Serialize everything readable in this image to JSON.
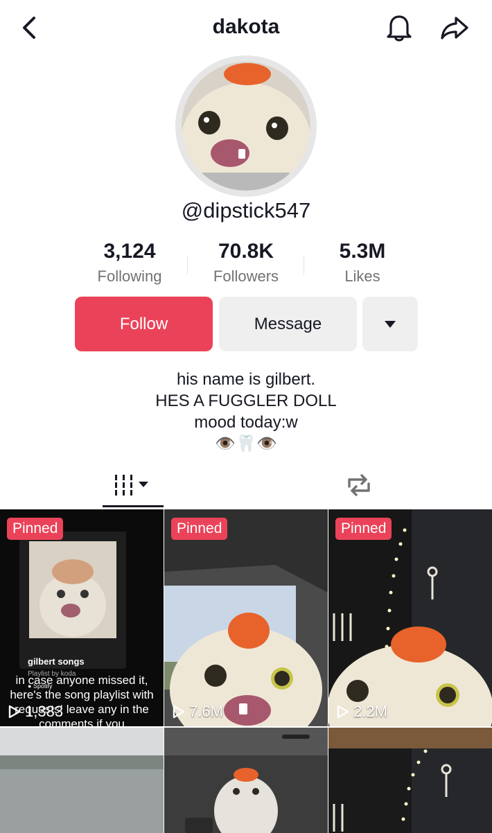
{
  "header": {
    "title": "dakota"
  },
  "profile": {
    "handle": "@dipstick547"
  },
  "stats": [
    {
      "value": "3,124",
      "label": "Following"
    },
    {
      "value": "70.8K",
      "label": "Followers"
    },
    {
      "value": "5.3M",
      "label": "Likes"
    }
  ],
  "actions": {
    "follow": "Follow",
    "message": "Message"
  },
  "bio": {
    "line1": "his name is gilbert.",
    "line2": "HES A FUGGLER DOLL",
    "line3": "mood today:w",
    "line4": "👁️🦷👁️"
  },
  "videos": [
    {
      "pinned": "Pinned",
      "views": "1,383",
      "overlay_text": "in case anyone missed it, here's the song playlist with requests! leave any in the comments if you",
      "playlist_title": "gilbert songs",
      "playlist_sub": "Playlist by koda",
      "playlist_source": "Spotify"
    },
    {
      "pinned": "Pinned",
      "views": "7.6M"
    },
    {
      "pinned": "Pinned",
      "views": "2.2M"
    },
    {
      "views": ""
    },
    {
      "views": ""
    },
    {
      "views": ""
    }
  ],
  "colors": {
    "accent": "#ea4359",
    "secondary_button": "#efefef",
    "muted_text": "#727272"
  },
  "icons": [
    "back-chevron-icon",
    "bell-icon",
    "share-arrow-icon",
    "dropdown-caret-icon",
    "grid-tab-icon",
    "repost-tab-icon",
    "play-icon"
  ]
}
